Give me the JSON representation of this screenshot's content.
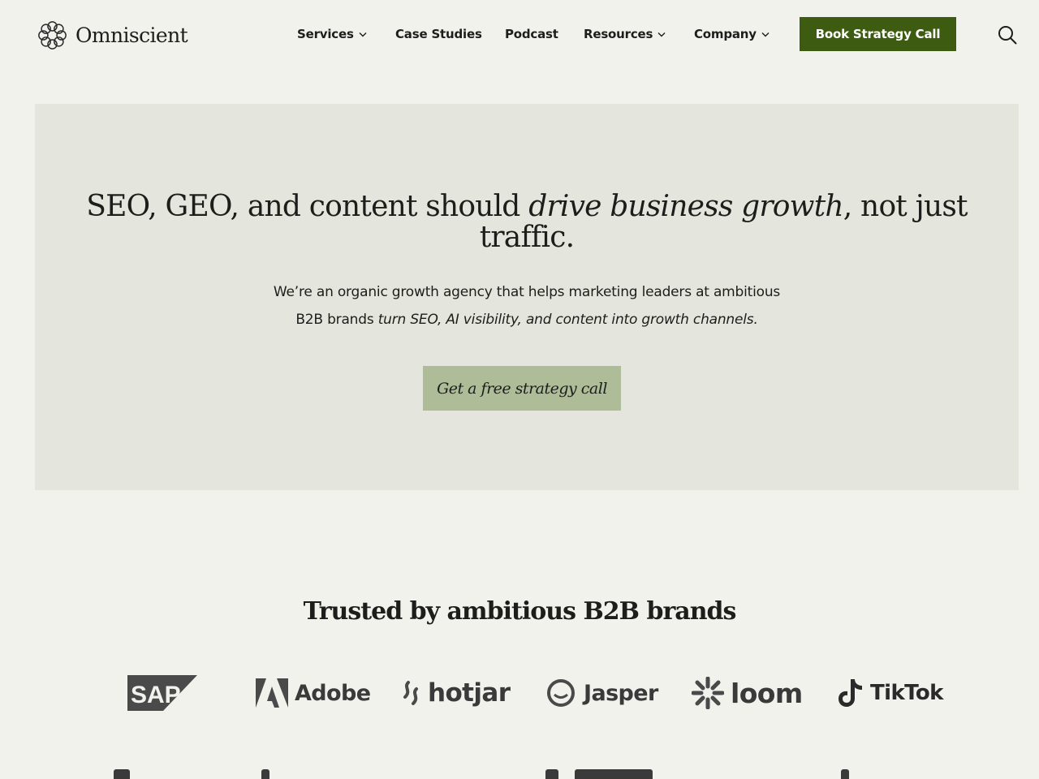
{
  "header": {
    "logo_text": "Omniscient",
    "nav": [
      {
        "label": "Services",
        "has_dropdown": true
      },
      {
        "label": "Case Studies",
        "has_dropdown": false
      },
      {
        "label": "Podcast",
        "has_dropdown": false
      },
      {
        "label": "Resources",
        "has_dropdown": true
      },
      {
        "label": "Company",
        "has_dropdown": true
      }
    ],
    "cta_label": "Book Strategy Call",
    "icons": {
      "logo": "omniscient-logo-icon",
      "search": "search-icon",
      "dropdown": "chevron-down-icon"
    }
  },
  "hero": {
    "title_part1": "SEO, GEO, and content should ",
    "title_em": "drive business growth",
    "title_part2": ", not just traffic.",
    "desc_line1": "We’re an organic growth agency that helps marketing leaders at ambitious",
    "desc_line2_plain": "B2B brands ",
    "desc_line2_em": "turn SEO, AI visibility, and content into growth channels.",
    "button_label": "Get a free strategy call"
  },
  "trusted": {
    "title": "Trusted by ambitious B2B brands",
    "brands": [
      {
        "name": "SAP"
      },
      {
        "name": "Adobe"
      },
      {
        "name": "hotjar"
      },
      {
        "name": "Jasper"
      },
      {
        "name": "loom"
      },
      {
        "name": "TikTok"
      }
    ]
  },
  "colors": {
    "page_bg": "#f2f2ed",
    "hero_bg": "#e4e6dd",
    "primary_button": "#3e5b12",
    "secondary_button": "#aebd98",
    "text": "#1d1d1b"
  }
}
